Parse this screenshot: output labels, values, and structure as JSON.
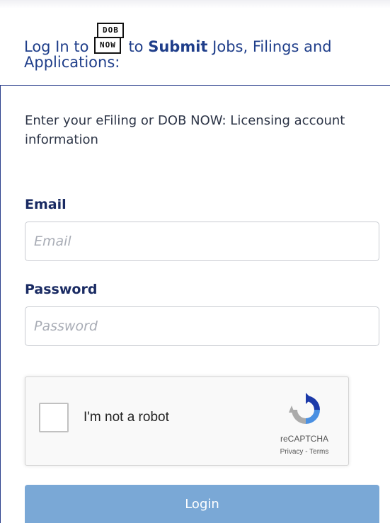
{
  "header": {
    "prefix": "Log In to",
    "logo_top": "DOB",
    "logo_bottom": "NOW",
    "middle": "to",
    "emphasis": "Submit",
    "suffix_line1": "Jobs, Filings and",
    "suffix_line2": "Applications:"
  },
  "form": {
    "intro": "Enter your eFiling or DOB NOW: Licensing account information",
    "email_label": "Email",
    "email_placeholder": "Email",
    "email_value": "",
    "password_label": "Password",
    "password_placeholder": "Password",
    "password_value": "",
    "login_label": "Login"
  },
  "captcha": {
    "text": "I'm not a robot",
    "brand": "reCAPTCHA",
    "privacy": "Privacy",
    "separator": " - ",
    "terms": "Terms",
    "icon": "recaptcha-icon"
  },
  "colors": {
    "header_text": "#1f3e8a",
    "label_text": "#1a2b63",
    "panel_border": "#2b3f8c",
    "login_button": "#7aa8d6"
  }
}
